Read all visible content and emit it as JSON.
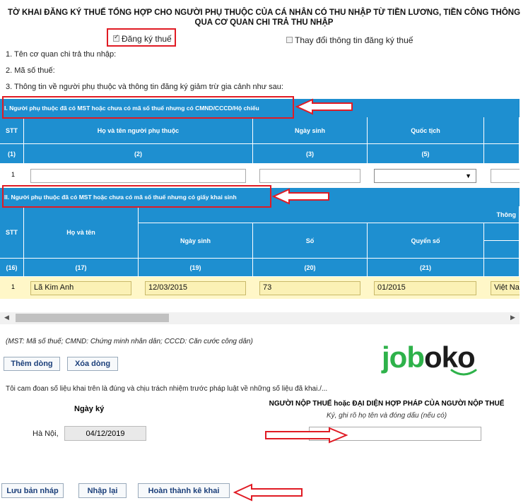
{
  "title": {
    "line1": "TỜ KHAI ĐĂNG KÝ THUẾ TỔNG HỢP CHO NGƯỜI PHỤ THUỘC CỦA CÁ NHÂN CÓ THU NHẬP TỪ TIỀN LƯƠNG, TIỀN CÔNG THÔNG",
    "line2": "QUA CƠ QUAN CHI TRẢ THU NHẬP"
  },
  "options": {
    "register_label": "Đăng ký thuế",
    "change_label": "Thay đổi thông tin đăng ký thuế"
  },
  "info": {
    "line1": "1. Tên cơ quan chi trả thu nhập:",
    "line2": "2. Mã số thuế:",
    "line3": "3. Thông tin về người phụ thuộc và thông tin đăng ký giảm trừ gia cảnh như sau:"
  },
  "section1": {
    "title": "I. Người phụ thuộc đã có MST hoặc chưa có mã số thuế nhưng có CMND/CCCD/Hộ chiếu",
    "headers": [
      "STT",
      "Họ và tên người phụ thuộc",
      "Ngày sinh",
      "Quốc tịch"
    ],
    "codes": [
      "(1)",
      "(2)",
      "(3)",
      "(5)"
    ],
    "row_stt": "1",
    "select_arrow": "▼"
  },
  "section2": {
    "title": "II. Người phụ thuộc đã có MST hoặc chưa có mã số thuế nhưng có giấy khai sinh",
    "group_header": "Thông",
    "headers": [
      "STT",
      "Họ và tên",
      "Ngày sinh",
      "Số",
      "Quyển số"
    ],
    "codes": [
      "(16)",
      "(17)",
      "(19)",
      "(20)",
      "(21)"
    ],
    "row": {
      "stt": "1",
      "name": "Lã Kim Anh",
      "dob": "12/03/2015",
      "number": "73",
      "book": "01/2015",
      "nationality": "Việt Na"
    }
  },
  "scroll": {
    "left": "◀",
    "right": "▶"
  },
  "note": "(MST: Mã số thuế; CMND: Chứng minh nhân dân; CCCD: Căn cước công dân)",
  "row_buttons": {
    "add": "Thêm dòng",
    "delete": "Xóa dòng"
  },
  "logo": {
    "j": "j",
    "o1": "o",
    "b": "b",
    "rest": "oko"
  },
  "declaration": "Tôi cam đoan số liệu khai trên là đúng và chịu trách nhiệm trước pháp luật về những số liệu đã khai./...",
  "sign": {
    "date_label": "Ngày ký",
    "place": "Hà Nội,",
    "date_value": "04/12/2019",
    "signer_title": "NGƯỜI NỘP THUẾ hoặc ĐẠI DIỆN HỢP PHÁP CỦA NGƯỜI NỘP THUẾ",
    "signer_sub": "Ký, ghi rõ họ tên và đóng dấu (nếu có)"
  },
  "actions": {
    "save_draft": "Lưu bản nháp",
    "reset": "Nhập lại",
    "finish": "Hoàn thành kê khai"
  },
  "colors": {
    "header_blue": "#1e8fd0",
    "highlight_red": "#e01b24",
    "row_yellow": "#fff7c8",
    "logo_green": "#2eb24a"
  }
}
